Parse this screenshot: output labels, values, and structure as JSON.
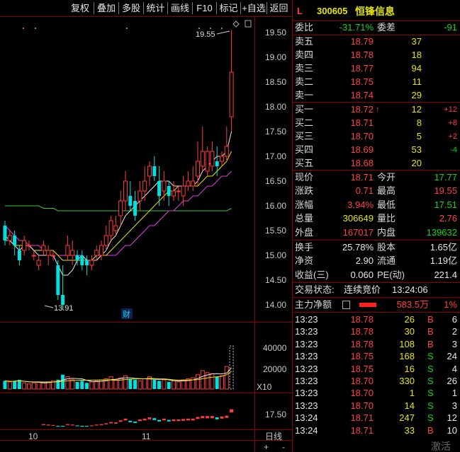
{
  "toolbar": {
    "buttons": [
      "复权",
      "叠加",
      "多股",
      "统计",
      "画线",
      "F10",
      "标记",
      "+自选",
      "返回"
    ]
  },
  "chart": {
    "price_axis": [
      "19.50",
      "19.00",
      "18.50",
      "18.00",
      "17.50",
      "17.00",
      "16.50",
      "16.00",
      "15.50",
      "15.00",
      "14.50",
      "14.00"
    ],
    "high_label": "19.55",
    "low_label": "13.91",
    "cai_badge": "财",
    "volume_axis": [
      "40000",
      "20000"
    ],
    "volume_unit": "X10",
    "bottom_axis": [
      "17.50"
    ],
    "date_labels": [
      "10",
      "11"
    ],
    "period_button": "日线",
    "zoom_in": "+",
    "zoom_out": "-"
  },
  "header": {
    "market": "L",
    "code": "300605",
    "name": "恒锋信息"
  },
  "weibi": {
    "label1": "委比",
    "value1": "-31.71%",
    "label2": "委差",
    "value2": "-91"
  },
  "sell_orders": [
    {
      "label": "卖五",
      "price": "18.79",
      "volume": "37"
    },
    {
      "label": "卖四",
      "price": "18.78",
      "volume": "18"
    },
    {
      "label": "卖三",
      "price": "18.77",
      "volume": "94"
    },
    {
      "label": "卖二",
      "price": "18.75",
      "volume": "11"
    },
    {
      "label": "卖一",
      "price": "18.74",
      "volume": "29"
    }
  ],
  "buy_orders": [
    {
      "label": "买一",
      "price": "18.72",
      "arrow": "↑",
      "volume": "12",
      "change": "+12"
    },
    {
      "label": "买二",
      "price": "18.71",
      "arrow": "",
      "volume": "8",
      "change": "+8"
    },
    {
      "label": "买三",
      "price": "18.70",
      "arrow": "",
      "volume": "5",
      "change": "+2"
    },
    {
      "label": "买四",
      "price": "18.69",
      "arrow": "",
      "volume": "53",
      "change": "-4"
    },
    {
      "label": "买五",
      "price": "18.68",
      "arrow": "",
      "volume": "20",
      "change": ""
    }
  ],
  "quote": [
    {
      "l1": "现价",
      "v1": "18.71",
      "l2": "今开",
      "v2": "17.77"
    },
    {
      "l1": "涨跌",
      "v1": "0.71",
      "l2": "最高",
      "v2": "19.55"
    },
    {
      "l1": "涨幅",
      "v1": "3.94%",
      "l2": "最低",
      "v2": "17.51"
    },
    {
      "l1": "总量",
      "v1": "306649",
      "l2": "量比",
      "v2": "2.76"
    },
    {
      "l1": "外盘",
      "v1": "167017",
      "l2": "内盘",
      "v2": "139632"
    }
  ],
  "fundamentals": [
    {
      "l1": "换手",
      "v1": "25.78%",
      "l2": "股本",
      "v2": "1.65亿"
    },
    {
      "l1": "净资",
      "v1": "2.90",
      "l2": "流通",
      "v2": "1.19亿"
    },
    {
      "l1": "收益(三)",
      "v1": "0.060",
      "l2": "PE(动)",
      "v2": "221.4"
    }
  ],
  "trade_status": {
    "label": "交易状态:",
    "value": "连续竞价",
    "time": "13:24:06"
  },
  "main_force": {
    "label": "主力净额",
    "value": "583.5万",
    "percent": "1%"
  },
  "ticks": [
    {
      "time": "13:23",
      "price": "18.78",
      "vol": "26",
      "side": "B",
      "num": "6"
    },
    {
      "time": "13:23",
      "price": "18.78",
      "vol": "30",
      "side": "B",
      "num": "2"
    },
    {
      "time": "13:23",
      "price": "18.78",
      "vol": "108",
      "side": "B",
      "num": "3"
    },
    {
      "time": "13:23",
      "price": "18.75",
      "vol": "168",
      "side": "S",
      "num": "24"
    },
    {
      "time": "13:23",
      "price": "18.75",
      "vol": "16",
      "side": "S",
      "num": "4"
    },
    {
      "time": "13:23",
      "price": "18.70",
      "vol": "330",
      "side": "S",
      "num": "26"
    },
    {
      "time": "13:23",
      "price": "18.70",
      "vol": "1",
      "side": "S",
      "num": "1"
    },
    {
      "time": "13:23",
      "price": "18.70",
      "vol": "14",
      "side": "S",
      "num": "3"
    },
    {
      "time": "13:24",
      "price": "18.71",
      "vol": "247",
      "side": "S",
      "num": "12"
    },
    {
      "time": "13:24",
      "price": "18.71",
      "vol": "33",
      "side": "B",
      "num": "10"
    }
  ],
  "watermark": "激活",
  "colors": {
    "up": "#ff3c3c",
    "down": "#00e0e0",
    "ma5": "#e8e8e8",
    "ma10": "#e6e600",
    "ma20": "#e040e0",
    "ma60": "#33cc33",
    "frame": "#8b0000"
  },
  "chart_data": {
    "type": "candlestick",
    "y_range": [
      13.8,
      19.8
    ],
    "candles": [
      [
        15.6,
        15.3,
        15.7,
        15.2
      ],
      [
        15.3,
        15.4,
        15.5,
        15.2
      ],
      [
        15.4,
        15.2,
        15.5,
        15.0
      ],
      [
        15.1,
        14.9,
        15.2,
        14.8
      ],
      [
        15.1,
        15.3,
        15.4,
        15.0
      ],
      [
        15.2,
        15.2,
        15.3,
        15.1
      ],
      [
        15.0,
        15.0,
        15.1,
        14.9
      ],
      [
        14.8,
        14.9,
        15.0,
        14.7
      ],
      [
        15.1,
        15.2,
        15.3,
        15.0
      ],
      [
        15.0,
        15.1,
        15.2,
        14.8
      ],
      [
        15.0,
        15.0,
        15.1,
        14.9
      ],
      [
        14.8,
        14.2,
        14.9,
        14.1
      ],
      [
        14.2,
        14.0,
        14.8,
        13.9
      ],
      [
        15.0,
        15.2,
        15.4,
        14.9
      ],
      [
        15.0,
        15.1,
        15.3,
        14.8
      ],
      [
        15.0,
        14.9,
        15.1,
        14.8
      ],
      [
        15.0,
        14.8,
        15.1,
        14.7
      ],
      [
        14.9,
        14.8,
        15.0,
        14.6
      ],
      [
        14.8,
        14.9,
        15.0,
        14.7
      ],
      [
        15.0,
        15.1,
        15.2,
        14.9
      ],
      [
        15.0,
        15.2,
        15.3,
        14.9
      ],
      [
        15.2,
        15.4,
        15.6,
        15.1
      ],
      [
        15.4,
        15.7,
        15.8,
        15.3
      ],
      [
        15.5,
        15.6,
        15.8,
        15.4
      ],
      [
        15.8,
        16.1,
        16.3,
        15.6
      ],
      [
        16.1,
        16.5,
        16.7,
        15.9
      ],
      [
        16.2,
        16.0,
        16.5,
        15.9
      ],
      [
        16.1,
        15.8,
        16.3,
        15.7
      ],
      [
        16.1,
        16.3,
        16.5,
        15.9
      ],
      [
        16.3,
        16.5,
        16.8,
        16.1
      ],
      [
        16.6,
        16.8,
        16.9,
        16.4
      ],
      [
        16.8,
        16.6,
        17.0,
        16.5
      ],
      [
        16.5,
        16.2,
        16.8,
        16.0
      ],
      [
        16.3,
        16.5,
        16.7,
        16.1
      ],
      [
        16.4,
        16.2,
        16.5,
        16.0
      ],
      [
        16.2,
        16.3,
        16.5,
        16.1
      ],
      [
        16.3,
        16.3,
        16.4,
        16.1
      ],
      [
        16.2,
        16.4,
        16.6,
        16.0
      ],
      [
        16.4,
        16.5,
        16.7,
        16.3
      ],
      [
        16.4,
        16.5,
        16.8,
        16.3
      ],
      [
        16.6,
        16.9,
        17.3,
        16.4
      ],
      [
        16.8,
        17.1,
        17.6,
        16.7
      ],
      [
        16.7,
        17.1,
        17.2,
        16.6
      ],
      [
        16.8,
        17.1,
        17.3,
        16.7
      ],
      [
        16.9,
        16.8,
        17.2,
        16.6
      ],
      [
        16.9,
        17.0,
        17.1,
        16.8
      ],
      [
        17.0,
        17.2,
        17.6,
        16.9
      ],
      [
        17.8,
        18.7,
        19.55,
        17.5
      ]
    ],
    "ma5": [
      15.4,
      15.3,
      15.2,
      15.1,
      15.2,
      15.2,
      15.1,
      15.0,
      15.0,
      15.0,
      15.0,
      14.8,
      14.6,
      14.6,
      14.7,
      14.9,
      15.0,
      14.9,
      14.9,
      14.9,
      15.0,
      15.1,
      15.3,
      15.4,
      15.6,
      15.8,
      15.9,
      16.0,
      16.1,
      16.2,
      16.3,
      16.4,
      16.5,
      16.5,
      16.5,
      16.4,
      16.4,
      16.4,
      16.4,
      16.4,
      16.5,
      16.7,
      16.8,
      16.9,
      17.0,
      17.0,
      17.1,
      17.5
    ],
    "ma10": [
      15.3,
      15.3,
      15.2,
      15.2,
      15.2,
      15.2,
      15.1,
      15.1,
      15.1,
      15.1,
      15.1,
      15.0,
      14.9,
      14.9,
      14.9,
      14.9,
      14.9,
      14.9,
      14.9,
      15.0,
      15.0,
      15.0,
      15.1,
      15.2,
      15.3,
      15.4,
      15.5,
      15.6,
      15.7,
      15.8,
      15.9,
      16.0,
      16.1,
      16.2,
      16.3,
      16.3,
      16.4,
      16.4,
      16.4,
      16.4,
      16.4,
      16.5,
      16.6,
      16.6,
      16.7,
      16.8,
      16.9,
      17.1
    ],
    "ma20": [
      15.6,
      15.5,
      15.4,
      15.3,
      15.3,
      15.2,
      15.2,
      15.2,
      15.1,
      15.1,
      15.1,
      15.0,
      15.0,
      15.0,
      15.0,
      15.0,
      15.0,
      14.9,
      14.9,
      14.9,
      15.0,
      15.0,
      15.0,
      15.0,
      15.1,
      15.2,
      15.2,
      15.3,
      15.4,
      15.5,
      15.6,
      15.6,
      15.7,
      15.8,
      15.9,
      15.9,
      16.0,
      16.1,
      16.1,
      16.2,
      16.2,
      16.3,
      16.4,
      16.4,
      16.5,
      16.6,
      16.6,
      16.7
    ],
    "ma60": [
      16.0,
      16.0,
      16.0,
      16.0,
      16.0,
      16.0,
      16.0,
      16.0,
      15.95,
      15.95,
      15.95,
      15.9,
      15.9,
      15.9,
      15.9,
      15.9,
      15.9,
      15.9,
      15.9,
      15.9,
      15.9,
      15.9,
      15.9,
      15.9,
      15.9,
      15.9,
      15.9,
      15.9,
      15.9,
      15.9,
      15.9,
      15.9,
      15.9,
      15.9,
      15.9,
      15.9,
      15.9,
      15.9,
      15.9,
      15.9,
      15.9,
      15.9,
      15.9,
      15.9,
      15.9,
      15.9,
      15.9,
      15.95
    ],
    "volume": [
      8000,
      7000,
      8000,
      9000,
      6000,
      5000,
      6000,
      7000,
      6000,
      7000,
      8000,
      9000,
      14000,
      12000,
      9000,
      7000,
      8000,
      6000,
      7000,
      8000,
      9000,
      10000,
      12000,
      9000,
      11000,
      13000,
      10000,
      9000,
      8000,
      10000,
      12000,
      9000,
      8000,
      9000,
      7000,
      8000,
      7000,
      9000,
      10000,
      11000,
      14000,
      18000,
      16000,
      15000,
      12000,
      13000,
      22000,
      42000
    ],
    "volume_range": [
      0,
      48000
    ],
    "lower_range": [
      17.2,
      17.8
    ]
  }
}
